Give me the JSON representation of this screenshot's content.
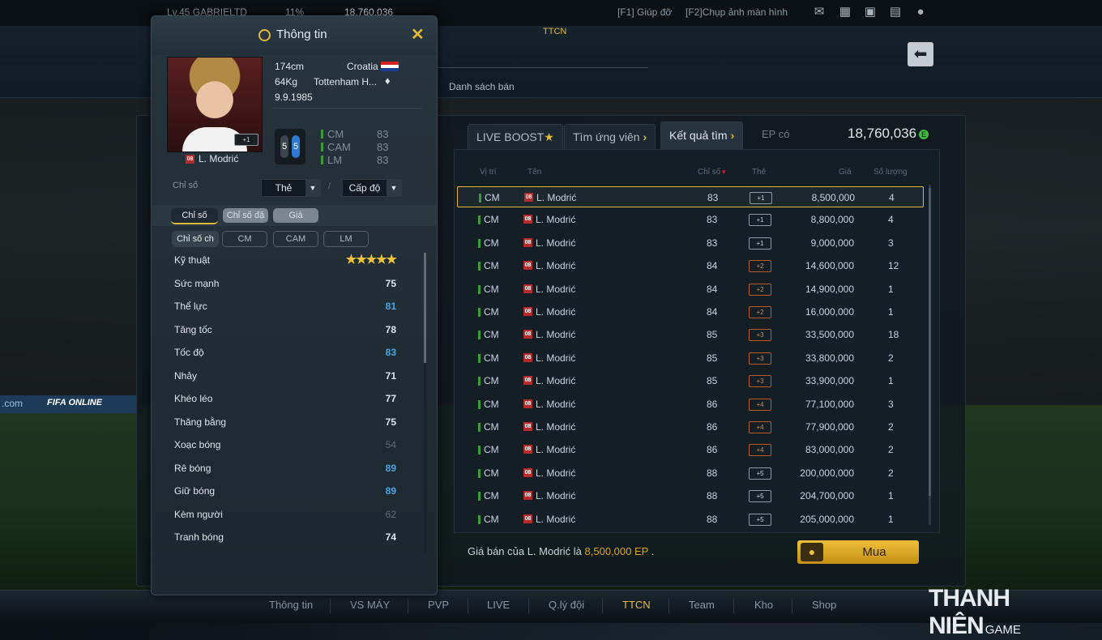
{
  "topbar": {
    "user": "Lv.45 GABRIELTD",
    "pct": "11%",
    "money": "18,760,036",
    "help": "[F1] Giúp đỡ",
    "screenshot": "[F2]Chụp ảnh màn hình",
    "icons": [
      "mail-icon",
      "list-icon",
      "calendar-icon",
      "chat-icon",
      "user-icon"
    ]
  },
  "banner": {
    "section": "TTCN",
    "sale_list": "Danh sách bán"
  },
  "market": {
    "tabs": [
      "LIVE BOOST",
      "Tìm ứng viên",
      "Kết quả tìm"
    ],
    "ep_label": "EP có",
    "ep_value": "18,760,036",
    "columns": {
      "pos": "Vị trí",
      "name": "Tên",
      "ovr": "Chỉ số",
      "card": "Thẻ",
      "price": "Giá",
      "qty": "Số lượng"
    },
    "rows": [
      {
        "pos": "CM",
        "season": "08",
        "name": "L. Modrić",
        "ovr": "83",
        "card": "+1",
        "price": "8,500,000",
        "qty": "4"
      },
      {
        "pos": "CM",
        "season": "08",
        "name": "L. Modrić",
        "ovr": "83",
        "card": "+1",
        "price": "8,800,000",
        "qty": "4"
      },
      {
        "pos": "CM",
        "season": "08",
        "name": "L. Modrić",
        "ovr": "83",
        "card": "+1",
        "price": "9,000,000",
        "qty": "3"
      },
      {
        "pos": "CM",
        "season": "08",
        "name": "L. Modrić",
        "ovr": "84",
        "card": "+2",
        "price": "14,600,000",
        "qty": "12"
      },
      {
        "pos": "CM",
        "season": "08",
        "name": "L. Modrić",
        "ovr": "84",
        "card": "+2",
        "price": "14,900,000",
        "qty": "1"
      },
      {
        "pos": "CM",
        "season": "08",
        "name": "L. Modrić",
        "ovr": "84",
        "card": "+2",
        "price": "16,000,000",
        "qty": "1"
      },
      {
        "pos": "CM",
        "season": "08",
        "name": "L. Modrić",
        "ovr": "85",
        "card": "+3",
        "price": "33,500,000",
        "qty": "18"
      },
      {
        "pos": "CM",
        "season": "08",
        "name": "L. Modrić",
        "ovr": "85",
        "card": "+3",
        "price": "33,800,000",
        "qty": "2"
      },
      {
        "pos": "CM",
        "season": "08",
        "name": "L. Modrić",
        "ovr": "85",
        "card": "+3",
        "price": "33,900,000",
        "qty": "1"
      },
      {
        "pos": "CM",
        "season": "08",
        "name": "L. Modrić",
        "ovr": "86",
        "card": "+4",
        "price": "77,100,000",
        "qty": "3"
      },
      {
        "pos": "CM",
        "season": "08",
        "name": "L. Modrić",
        "ovr": "86",
        "card": "+4",
        "price": "77,900,000",
        "qty": "2"
      },
      {
        "pos": "CM",
        "season": "08",
        "name": "L. Modrić",
        "ovr": "86",
        "card": "+4",
        "price": "83,000,000",
        "qty": "2"
      },
      {
        "pos": "CM",
        "season": "08",
        "name": "L. Modrić",
        "ovr": "88",
        "card": "+5",
        "price": "200,000,000",
        "qty": "2"
      },
      {
        "pos": "CM",
        "season": "08",
        "name": "L. Modrić",
        "ovr": "88",
        "card": "+5",
        "price": "204,700,000",
        "qty": "1"
      },
      {
        "pos": "CM",
        "season": "08",
        "name": "L. Modrić",
        "ovr": "88",
        "card": "+5",
        "price": "205,000,000",
        "qty": "1"
      }
    ],
    "footer_prefix": "Giá bán của L. Modrić là",
    "footer_price": "8,500,000 EP",
    "footer_suffix": ".",
    "buy_label": "Mua"
  },
  "nav": {
    "items": [
      "Thông tin",
      "VS MÁY",
      "PVP",
      "LIVE",
      "Q.lý đội",
      "TTCN",
      "Team",
      "Kho",
      "Shop"
    ],
    "active": "TTCN"
  },
  "watermark": {
    "brand": "THANH NIÊN",
    "suffix": "GAME"
  },
  "background": {
    "board_text": "FIFA ONLINE",
    "board_domain": ".com"
  },
  "popup": {
    "title": "Thông tin",
    "close": "✕",
    "player": {
      "name": "L. Modrić",
      "season": "08",
      "plus": "+1",
      "height": "174cm",
      "nation": "Croatia",
      "weight": "64Kg",
      "club": "Tottenham H...",
      "birth": "9.9.1985",
      "foot_left": "5",
      "foot_right": "5",
      "positions": [
        {
          "pos": "CM",
          "val": "83"
        },
        {
          "pos": "CAM",
          "val": "83"
        },
        {
          "pos": "LM",
          "val": "83"
        }
      ]
    },
    "filter_label": "Chỉ số",
    "dropdown_card": "Thẻ",
    "dropdown_level": "Cấp độ",
    "tabs": [
      "Chỉ số",
      "Chỉ số đặ",
      "Giá"
    ],
    "subtabs": [
      "Chỉ số ch",
      "CM",
      "CAM",
      "LM"
    ],
    "stats": [
      {
        "label": "Kỹ thuật",
        "value": "★★★★★",
        "style": "stars"
      },
      {
        "label": "Sức mạnh",
        "value": "75",
        "style": ""
      },
      {
        "label": "Thể lực",
        "value": "81",
        "style": "blue"
      },
      {
        "label": "Tăng tốc",
        "value": "78",
        "style": ""
      },
      {
        "label": "Tốc độ",
        "value": "83",
        "style": "blue"
      },
      {
        "label": "Nhảy",
        "value": "71",
        "style": ""
      },
      {
        "label": "Khéo léo",
        "value": "77",
        "style": ""
      },
      {
        "label": "Thăng bằng",
        "value": "75",
        "style": ""
      },
      {
        "label": "Xoạc bóng",
        "value": "54",
        "style": "dim"
      },
      {
        "label": "Rê bóng",
        "value": "89",
        "style": "blue"
      },
      {
        "label": "Giữ bóng",
        "value": "89",
        "style": "blue"
      },
      {
        "label": "Kèm người",
        "value": "62",
        "style": "dim"
      },
      {
        "label": "Tranh bóng",
        "value": "74",
        "style": ""
      }
    ]
  }
}
